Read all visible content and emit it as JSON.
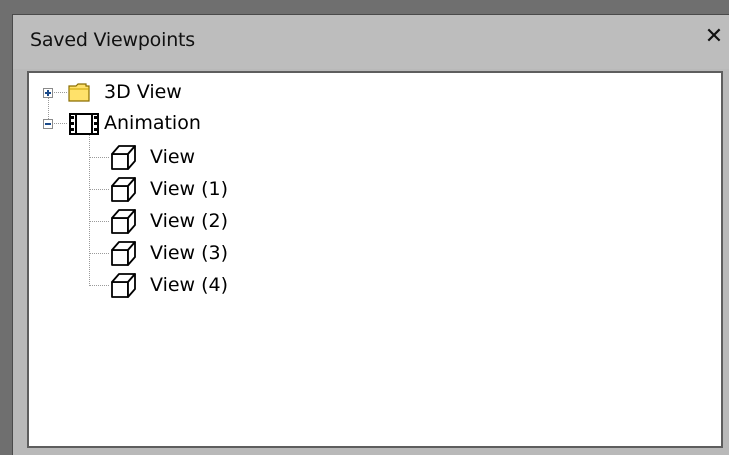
{
  "panel": {
    "title": "Saved Viewpoints",
    "close_glyph": "✕"
  },
  "tree": {
    "nodes": [
      {
        "label": "3D View",
        "icon": "folder-icon",
        "expanded": false
      },
      {
        "label": "Animation",
        "icon": "film-icon",
        "expanded": true,
        "children": [
          {
            "label": "View",
            "icon": "cube-icon"
          },
          {
            "label": "View (1)",
            "icon": "cube-icon"
          },
          {
            "label": "View (2)",
            "icon": "cube-icon"
          },
          {
            "label": "View (3)",
            "icon": "cube-icon"
          },
          {
            "label": "View (4)",
            "icon": "cube-icon"
          }
        ]
      }
    ]
  },
  "colors": {
    "panel_bg": "#b9b9b9",
    "tree_bg": "#ffffff",
    "folder_fill": "#ffe16a",
    "folder_stroke": "#8a6d00"
  }
}
